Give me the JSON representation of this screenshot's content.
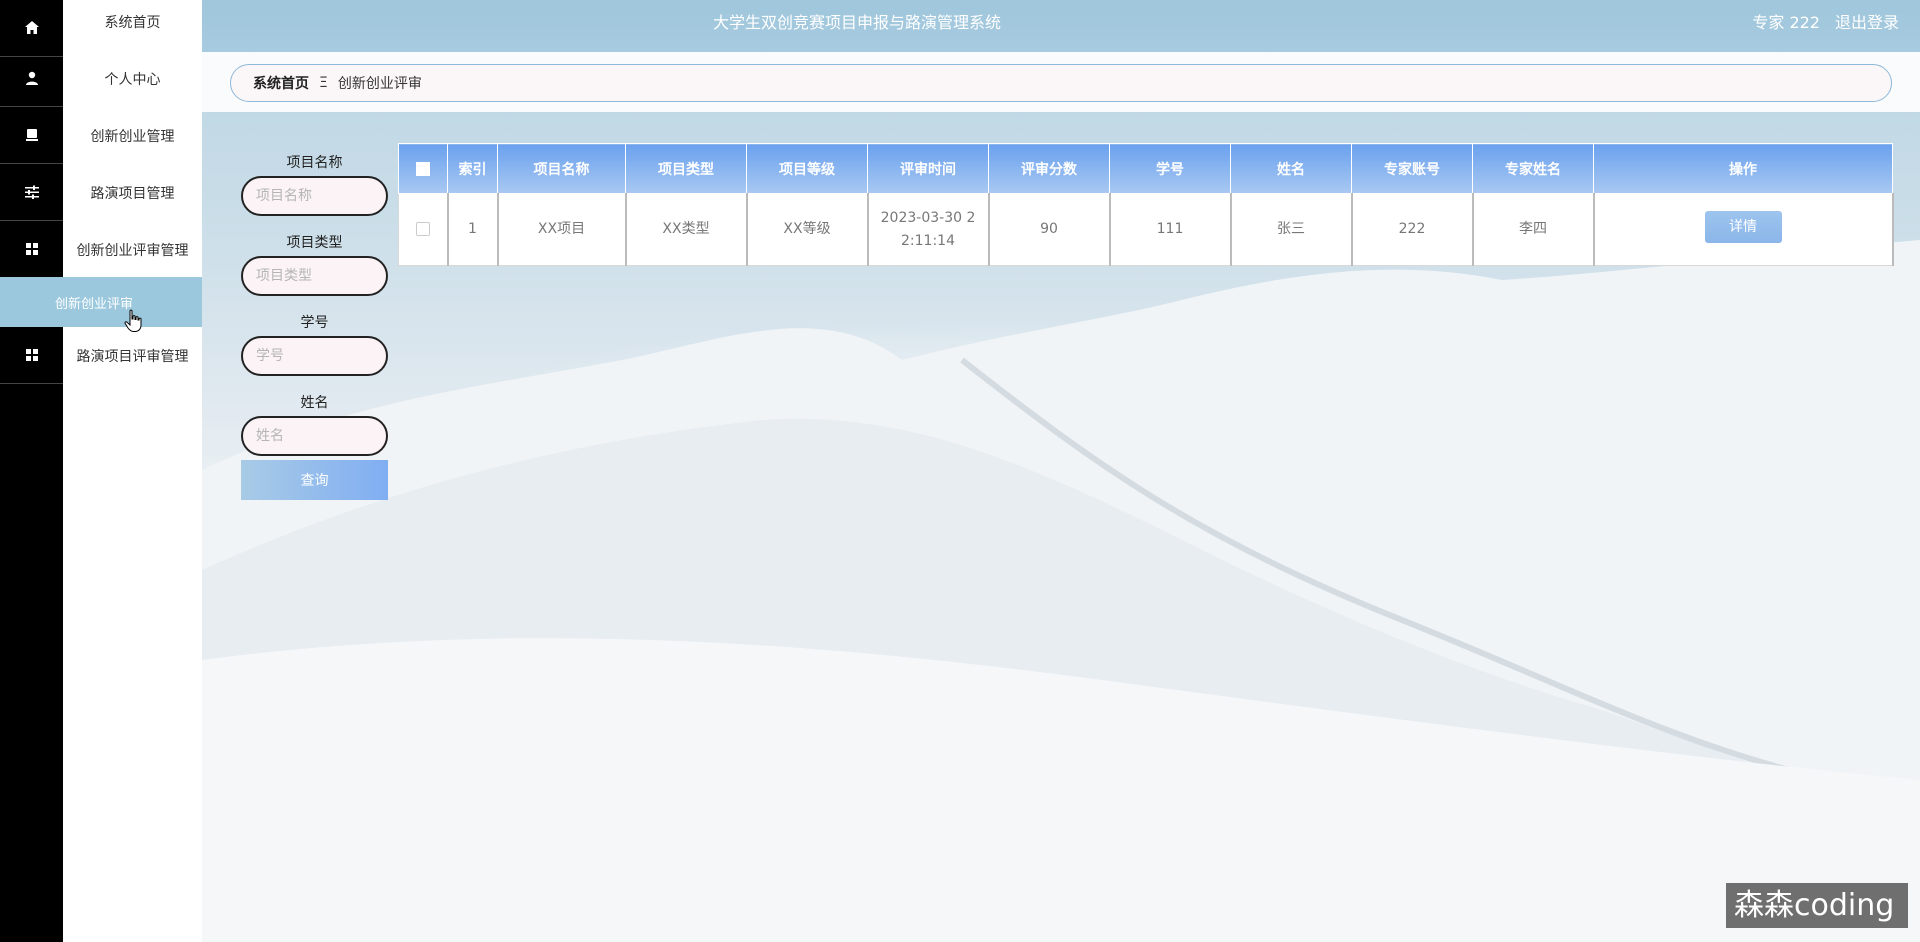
{
  "topbar": {
    "title": "大学生双创竞赛项目申报与路演管理系统",
    "user": "专家 222",
    "logout": "退出登录"
  },
  "sidebar": {
    "items": [
      {
        "label": "系统首页",
        "icon": "home-icon"
      },
      {
        "label": "个人中心",
        "icon": "user-icon"
      },
      {
        "label": "创新创业管理",
        "icon": "monitor-icon"
      },
      {
        "label": "路演项目管理",
        "icon": "sliders-icon"
      },
      {
        "label": "创新创业评审管理",
        "icon": "grid-icon"
      },
      {
        "label": "路演项目评审管理",
        "icon": "grid-icon"
      }
    ],
    "active_sub": "创新创业评审"
  },
  "breadcrumb": {
    "home": "系统首页",
    "separator": "Ξ",
    "current": "创新创业评审"
  },
  "search": {
    "fields": [
      {
        "label": "项目名称",
        "placeholder": "项目名称"
      },
      {
        "label": "项目类型",
        "placeholder": "项目类型"
      },
      {
        "label": "学号",
        "placeholder": "学号"
      },
      {
        "label": "姓名",
        "placeholder": "姓名"
      }
    ],
    "button": "查询"
  },
  "table": {
    "columns": [
      "索引",
      "项目名称",
      "项目类型",
      "项目等级",
      "评审时间",
      "评审分数",
      "学号",
      "姓名",
      "专家账号",
      "专家姓名",
      "操作"
    ],
    "rows": [
      {
        "index": "1",
        "name": "XX项目",
        "type": "XX类型",
        "level": "XX等级",
        "time": "2023-03-30 22:11:14",
        "score": "90",
        "student_id": "111",
        "student_name": "张三",
        "expert_account": "222",
        "expert_name": "李四",
        "action": "详情"
      }
    ]
  },
  "watermark": "森森coding",
  "colors": {
    "sidebar_bg": "#000000",
    "topbar_bg": "#a3c9de",
    "active_menu": "#9cc8de",
    "table_header": "#6ba1ee",
    "button_gradient_end": "#80aef2"
  }
}
